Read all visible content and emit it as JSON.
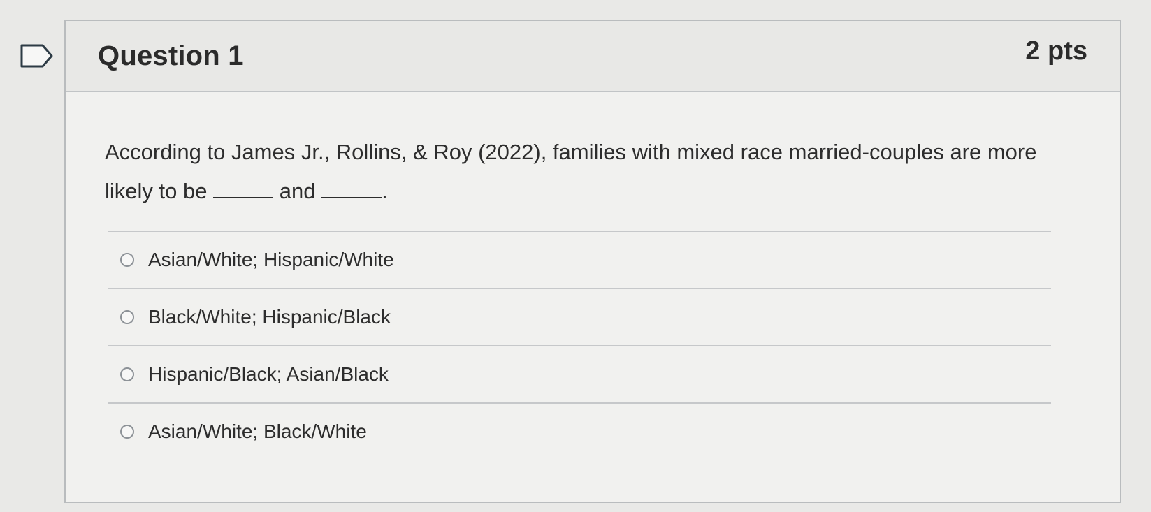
{
  "question": {
    "title": "Question 1",
    "points": "2 pts",
    "text_before": "According to James Jr., Rollins, & Roy (2022), families with mixed race married-couples are more likely to be",
    "text_middle": "and",
    "text_end": "."
  },
  "answers": [
    {
      "label": "Asian/White; Hispanic/White"
    },
    {
      "label": "Black/White; Hispanic/Black"
    },
    {
      "label": "Hispanic/Black; Asian/Black"
    },
    {
      "label": "Asian/White; Black/White"
    }
  ],
  "icons": {
    "flag": "flag-question-icon",
    "radio": "radio-button-icon"
  },
  "colors": {
    "background": "#e9e9e7",
    "card_header": "#e8e8e6",
    "text": "#2d2d2d",
    "border": "#b9bcbe"
  }
}
